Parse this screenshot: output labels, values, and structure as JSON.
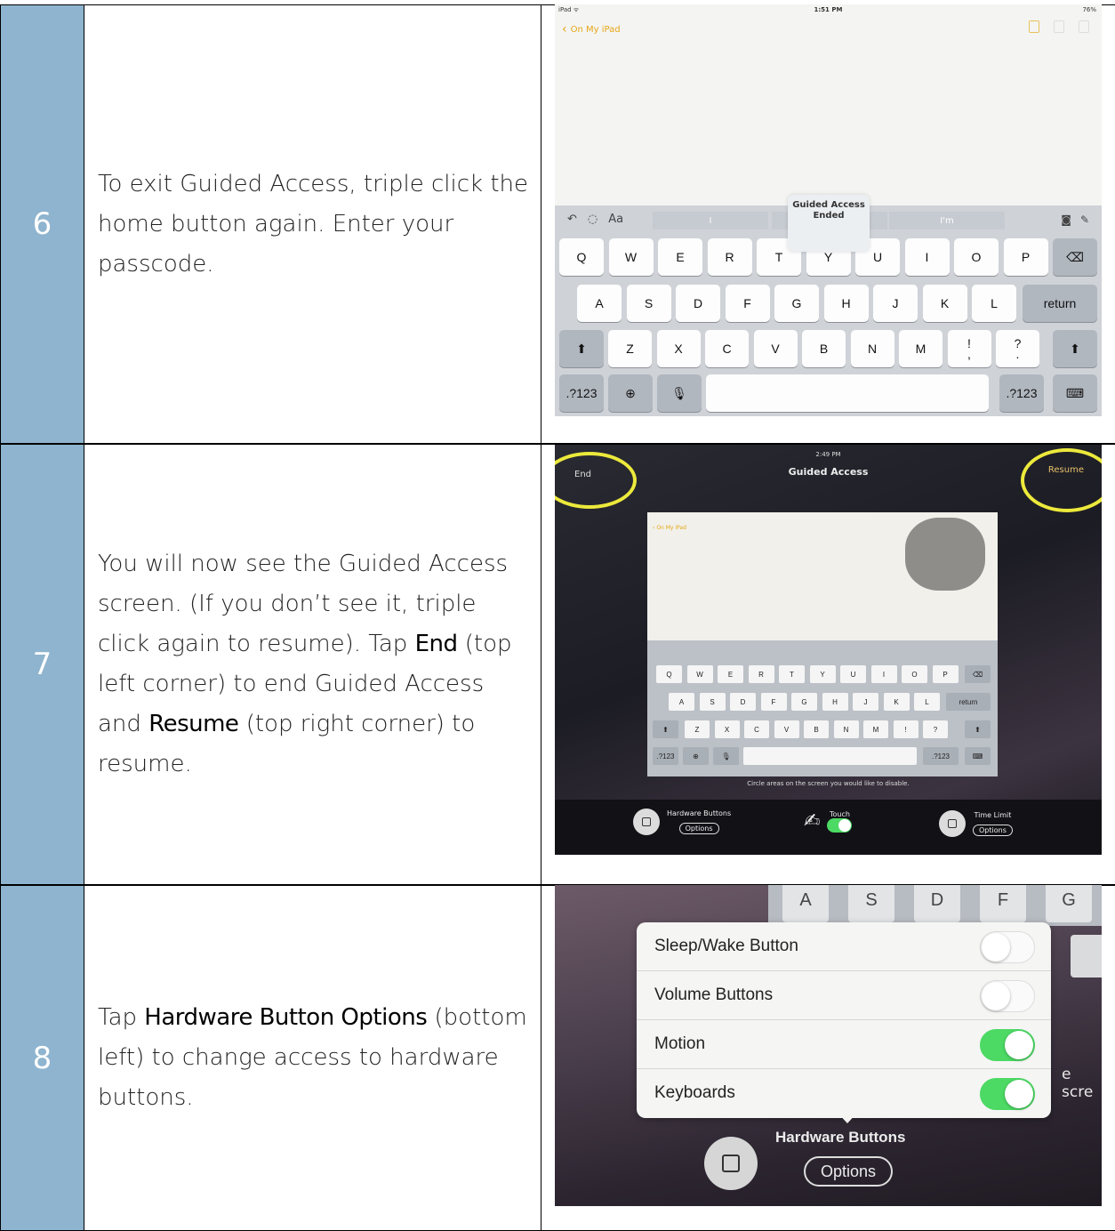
{
  "rows": [
    {
      "number": "6",
      "text": "To exit Guided Access, triple click the home button again.  Enter your passcode."
    },
    {
      "number": "7",
      "text_parts": [
        "You will now see the Guided Access screen.  (If you don’t see it, triple click again to resume).  Tap ",
        "End",
        " (top left corner) to end Guided Access and ",
        "Resume",
        " (top right corner) to resume."
      ]
    },
    {
      "number": "8",
      "text_parts": [
        "Tap ",
        "Hardware Button Options",
        " (bottom left) to change access to hardware buttons."
      ]
    }
  ],
  "shot1": {
    "status_left": "iPad ᯤ",
    "status_time": "1:51 PM",
    "status_right": "76%",
    "back_label": "On My iPad",
    "toast_title": "Guided Access",
    "toast_sub": "Ended",
    "suggestions": [
      "I",
      "",
      "I'm"
    ],
    "toolbar_aa": "Aa",
    "row1": [
      "Q",
      "W",
      "E",
      "R",
      "T",
      "Y",
      "U",
      "I",
      "O",
      "P"
    ],
    "row2": [
      "A",
      "S",
      "D",
      "F",
      "G",
      "H",
      "J",
      "K",
      "L"
    ],
    "row3": [
      "Z",
      "X",
      "C",
      "V",
      "B",
      "N",
      "M",
      "!\n,",
      "?\n."
    ],
    "return_label": "return",
    "num_label": ".?123"
  },
  "shot2": {
    "time": "2:49 PM",
    "title": "Guided Access",
    "end_label": "End",
    "resume_label": "Resume",
    "mini_back": "On My iPad",
    "hint": "Circle areas on the screen you would like to disable.",
    "hardware_label": "Hardware Buttons",
    "touch_label": "Touch",
    "time_limit_label": "Time Limit",
    "options_label": "Options",
    "mini_row1": [
      "Q",
      "W",
      "E",
      "R",
      "T",
      "Y",
      "U",
      "I",
      "O",
      "P"
    ],
    "mini_row2": [
      "A",
      "S",
      "D",
      "F",
      "G",
      "H",
      "J",
      "K",
      "L"
    ],
    "mini_row3": [
      "Z",
      "X",
      "C",
      "V",
      "B",
      "N",
      "M",
      "!",
      "?"
    ],
    "mini_return": "return",
    "mini_num": ".?123"
  },
  "shot3": {
    "bg_keys": [
      "A",
      "S",
      "D",
      "F",
      "G"
    ],
    "bg_text": "e scre",
    "popover_items": [
      {
        "label": "Sleep/Wake Button",
        "on": false
      },
      {
        "label": "Volume Buttons",
        "on": false
      },
      {
        "label": "Motion",
        "on": true
      },
      {
        "label": "Keyboards",
        "on": true
      }
    ],
    "hardware_label": "Hardware Buttons",
    "options_label": "Options"
  }
}
